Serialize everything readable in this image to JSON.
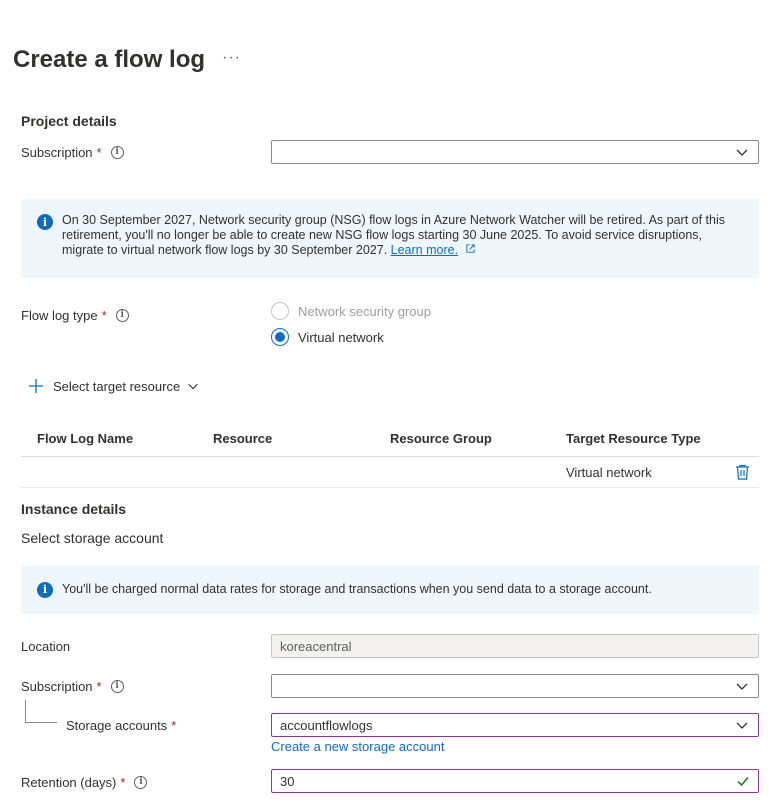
{
  "header": {
    "title": "Create a flow log",
    "more_label": "···"
  },
  "project": {
    "section_title": "Project details",
    "subscription_label": "Subscription",
    "required_mark": "*",
    "subscription_value": ""
  },
  "nsg_banner": {
    "text": "On 30 September 2027, Network security group (NSG) flow logs in Azure Network Watcher will be retired. As part of this retirement, you'll no longer be able to create new NSG flow logs starting 30 June 2025. To avoid service disruptions, migrate to virtual network flow logs by 30 September 2027.",
    "link_label": "Learn more."
  },
  "flow_log_type": {
    "label": "Flow log type",
    "options": [
      {
        "label": "Network security group",
        "selected": false,
        "disabled": true
      },
      {
        "label": "Virtual network",
        "selected": true,
        "disabled": false
      }
    ]
  },
  "target": {
    "select_label": "Select target resource"
  },
  "table": {
    "columns": [
      "Flow Log Name",
      "Resource",
      "Resource Group",
      "Target Resource Type"
    ],
    "rows": [
      {
        "flow_log_name": "",
        "resource": "",
        "resource_group": "",
        "target_resource_type": "Virtual network"
      }
    ]
  },
  "instance": {
    "section_title": "Instance details",
    "storage_subtitle": "Select storage account",
    "storage_banner": "You'll be charged normal data rates for storage and transactions when you send data to a storage account.",
    "location_label": "Location",
    "location_value": "koreacentral",
    "subscription_label": "Subscription",
    "subscription_value": "",
    "storage_accounts_label": "Storage accounts",
    "storage_accounts_value": "accountflowlogs",
    "create_storage_link": "Create a new storage account",
    "retention_label": "Retention (days)",
    "retention_value": "30"
  },
  "colors": {
    "accent": "#0f6cbd",
    "required": "#a4262c",
    "focus_border": "#8a3b8f",
    "valid_check": "#107c10",
    "banner_bg": "#eff6fc"
  },
  "icons": {
    "info": "info-icon",
    "chevron": "chevron-down-icon",
    "plus": "plus-icon",
    "delete": "trash-icon",
    "external": "external-link-icon",
    "check": "checkmark-icon"
  }
}
